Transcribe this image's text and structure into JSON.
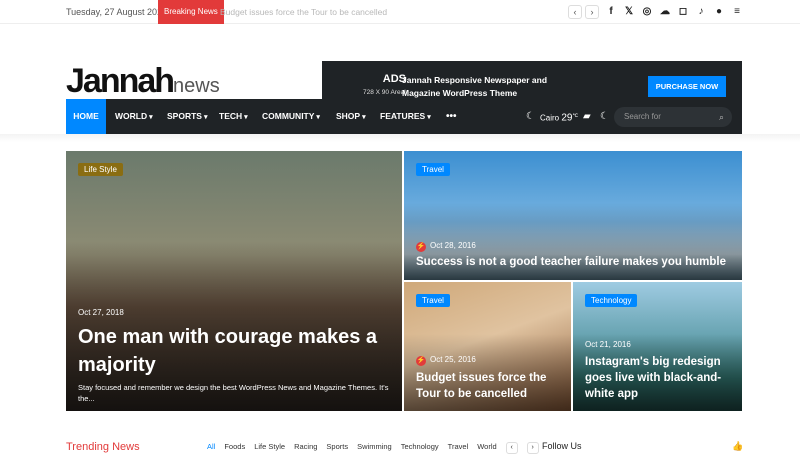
{
  "topbar": {
    "date": "Tuesday, 27 August 2024",
    "breaking_label": "Breaking News",
    "breaking_text": "Budget issues force the Tour to be cancelled",
    "prev": "‹",
    "next": "›",
    "social_icons": [
      "facebook-icon",
      "x-icon",
      "dribbble-icon",
      "soundcloud-icon",
      "instagram-icon",
      "tiktok-icon",
      "user-icon",
      "menu-icon"
    ]
  },
  "logo": {
    "main": "Jannah",
    "sub": "news"
  },
  "ad": {
    "title": "ADS",
    "size": "728 X 90 Area!",
    "text": "Jannah Responsive Newspaper and Magazine WordPress Theme",
    "button": "PURCHASE NOW"
  },
  "nav": {
    "items": [
      "HOME",
      "WORLD",
      "SPORTS",
      "TECH",
      "COMMUNITY",
      "SHOP",
      "FEATURES"
    ],
    "more": "•••",
    "weather_city": "Cairo",
    "weather_temp": "29",
    "weather_unit": "℃",
    "search_placeholder": "Search for"
  },
  "tiles": [
    {
      "category": "Life Style",
      "date": "Oct 27, 2018",
      "title": "One man with courage makes a majority",
      "excerpt": "Stay focused and remember we design the best WordPress News and Magazine Themes. It's the...",
      "cat_color": "#8a6d12"
    },
    {
      "category": "Travel",
      "date": "Oct 28, 2016",
      "title": "Success is not a good teacher failure makes you humble",
      "cat_color": "#0088ff"
    },
    {
      "category": "Travel",
      "date": "Oct 25, 2016",
      "title": "Budget issues force the Tour to be cancelled",
      "cat_color": "#0088ff"
    },
    {
      "category": "Technology",
      "date": "Oct 21, 2016",
      "title": "Instagram's big redesign goes live with black-and-white app",
      "cat_color": "#0088ff"
    }
  ],
  "bottom": {
    "trending": "Trending News",
    "filters": [
      "All",
      "Foods",
      "Life Style",
      "Racing",
      "Sports",
      "Swimming",
      "Technology",
      "Travel",
      "World"
    ],
    "follow": "Follow Us"
  },
  "colors": {
    "accent": "#0088ff",
    "breaking": "#e23a3a",
    "dark": "#1f2326"
  }
}
